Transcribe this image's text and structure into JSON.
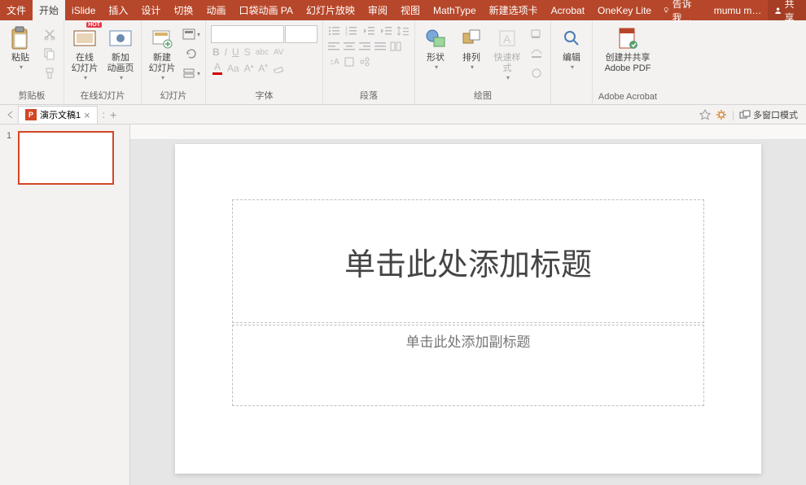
{
  "menu": {
    "items": [
      "文件",
      "开始",
      "iSlide",
      "插入",
      "设计",
      "切换",
      "动画",
      "口袋动画 PA",
      "幻灯片放映",
      "审阅",
      "视图",
      "MathType",
      "新建选项卡",
      "Acrobat",
      "OneKey Lite"
    ],
    "active_index": 1,
    "tell_me": "告诉我…",
    "user": "mumu m…",
    "share": "共享"
  },
  "ribbon": {
    "clipboard": {
      "paste": "粘贴",
      "label": "剪贴板"
    },
    "online_slides": {
      "online": "在线\n幻灯片",
      "anim": "新加\n动画页",
      "label": "在线幻灯片"
    },
    "slides": {
      "new_slide": "新建\n幻灯片",
      "label": "幻灯片"
    },
    "font": {
      "label": "字体",
      "bold": "B",
      "italic": "I",
      "underline": "U",
      "strike": "S",
      "shadow": "abc",
      "av": "AV"
    },
    "paragraph": {
      "label": "段落"
    },
    "drawing": {
      "shapes": "形状",
      "arrange": "排列",
      "quick_style": "快速样式",
      "label": "绘图"
    },
    "editing": {
      "edit": "编辑"
    },
    "acrobat": {
      "create": "创建并共享\nAdobe PDF",
      "label": "Adobe Acrobat"
    }
  },
  "doc_tab": {
    "name": "演示文稿1",
    "close": "×",
    "colon": ":",
    "plus": "+",
    "multi_window": "多窗口模式"
  },
  "thumbnail": {
    "number": "1"
  },
  "slide": {
    "title_placeholder": "单击此处添加标题",
    "subtitle_placeholder": "单击此处添加副标题"
  }
}
